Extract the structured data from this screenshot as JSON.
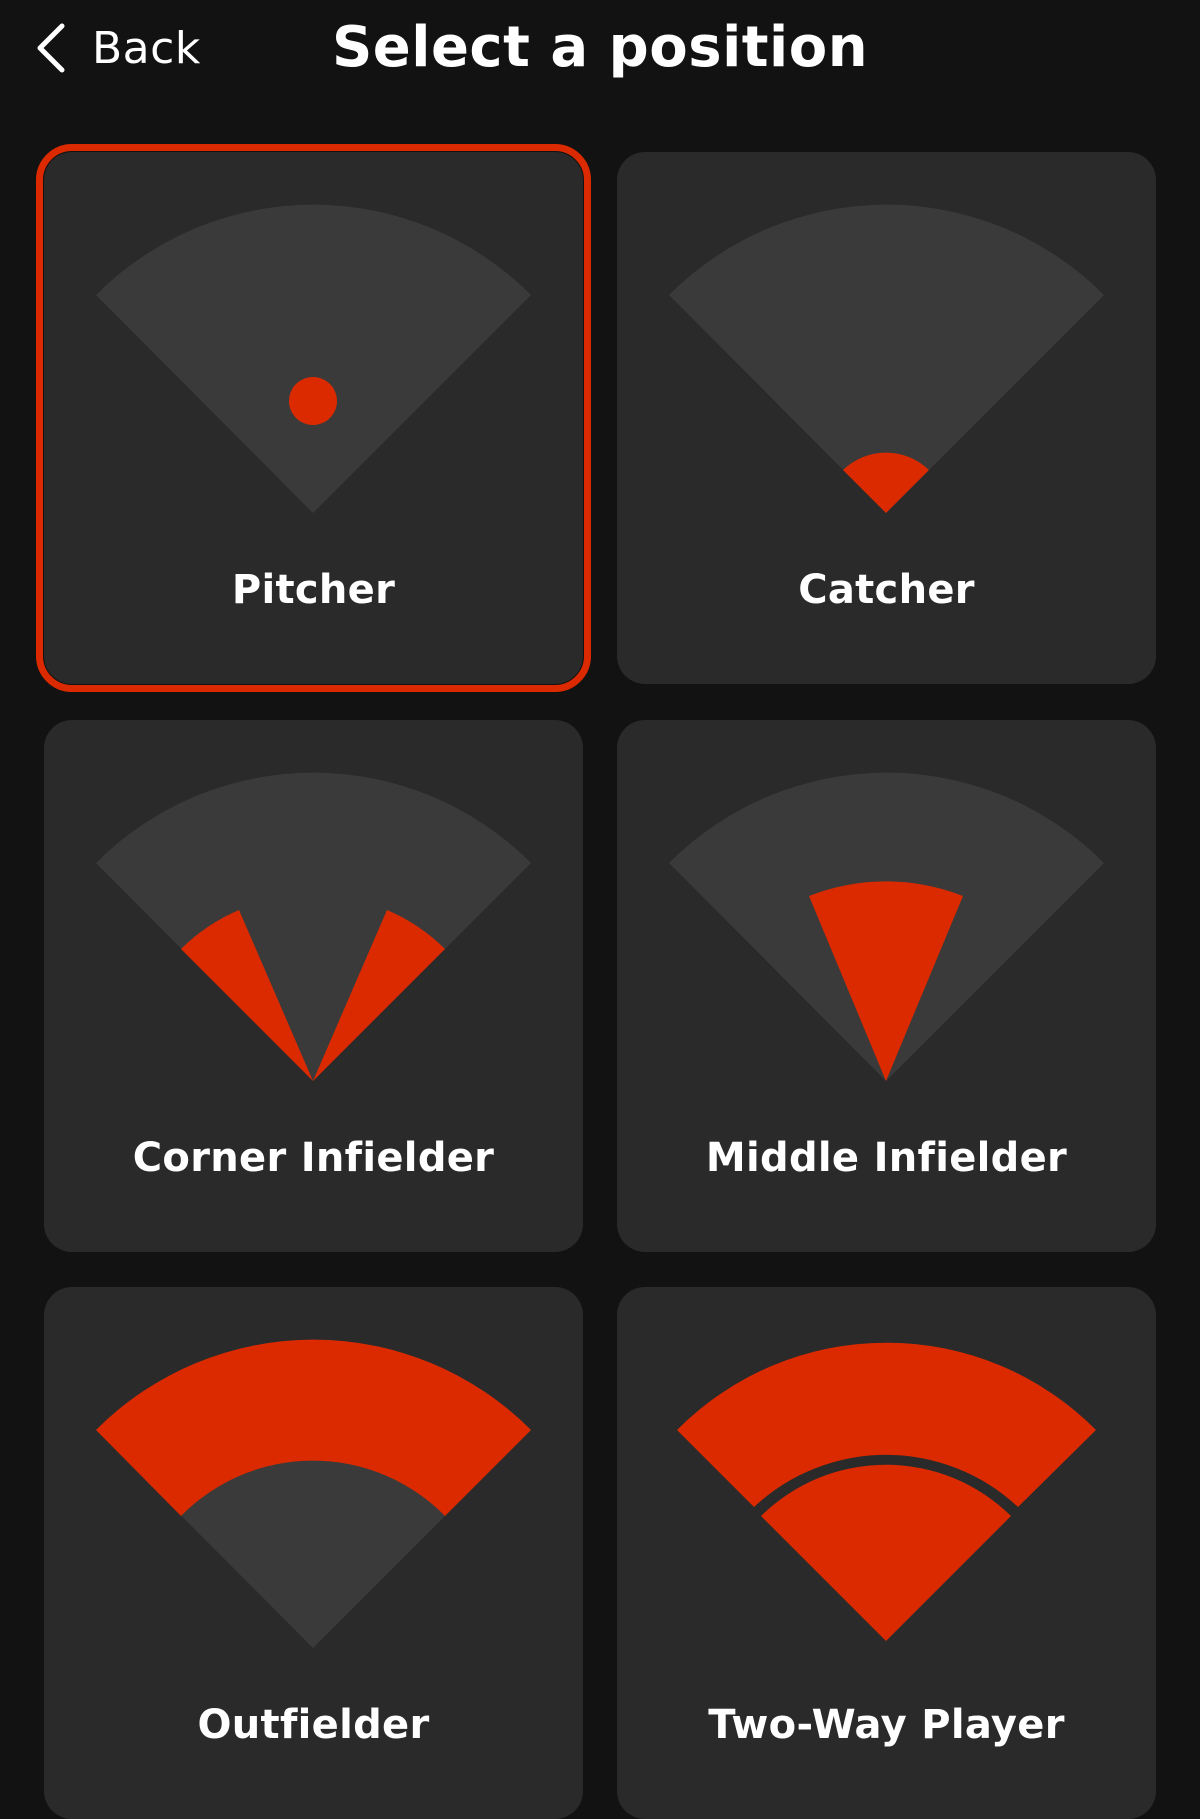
{
  "header": {
    "back_label": "Back",
    "title": "Select a position"
  },
  "colors": {
    "background": "#121212",
    "card": "#2a2a2a",
    "field": "#3a3a3a",
    "accent": "#dc2a00"
  },
  "positions": [
    {
      "label": "Pitcher",
      "selected": true
    },
    {
      "label": "Catcher",
      "selected": false
    },
    {
      "label": "Corner Infielder",
      "selected": false
    },
    {
      "label": "Middle Infielder",
      "selected": false
    },
    {
      "label": "Outfielder",
      "selected": false
    },
    {
      "label": "Two-Way Player",
      "selected": false
    }
  ]
}
